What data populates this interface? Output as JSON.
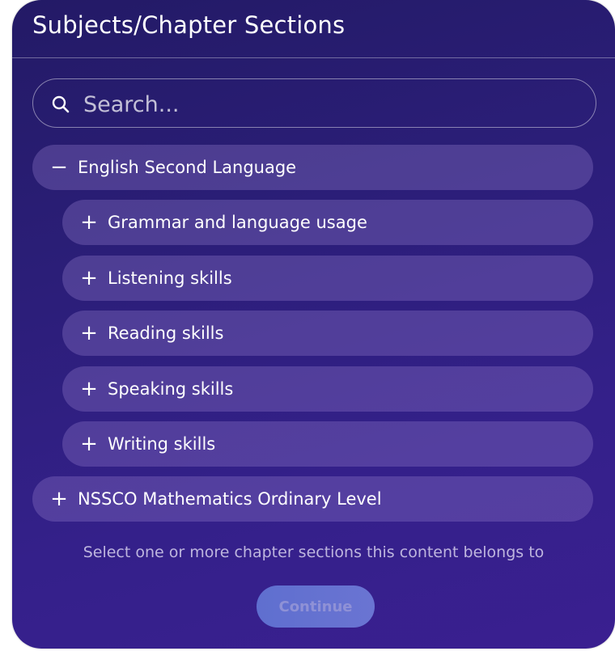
{
  "dialog": {
    "title": "Subjects/Chapter Sections"
  },
  "search": {
    "placeholder": "Search..."
  },
  "subjects": [
    {
      "sign": "−",
      "label": "English Second Language",
      "chapters": [
        {
          "sign": "+",
          "label": "Grammar and language usage"
        },
        {
          "sign": "+",
          "label": "Listening skills"
        },
        {
          "sign": "+",
          "label": "Reading skills"
        },
        {
          "sign": "+",
          "label": "Speaking skills"
        },
        {
          "sign": "+",
          "label": "Writing skills"
        }
      ]
    },
    {
      "sign": "+",
      "label": "NSSCO Mathematics Ordinary Level",
      "chapters": []
    }
  ],
  "helper_text": "Select one or more chapter sections this content belongs to",
  "buttons": {
    "continue_label": "Continue"
  },
  "colors": {
    "panel_background": "#2b1e78",
    "row_background": "#6b5aa8",
    "continue_background": "#6a74d2"
  }
}
